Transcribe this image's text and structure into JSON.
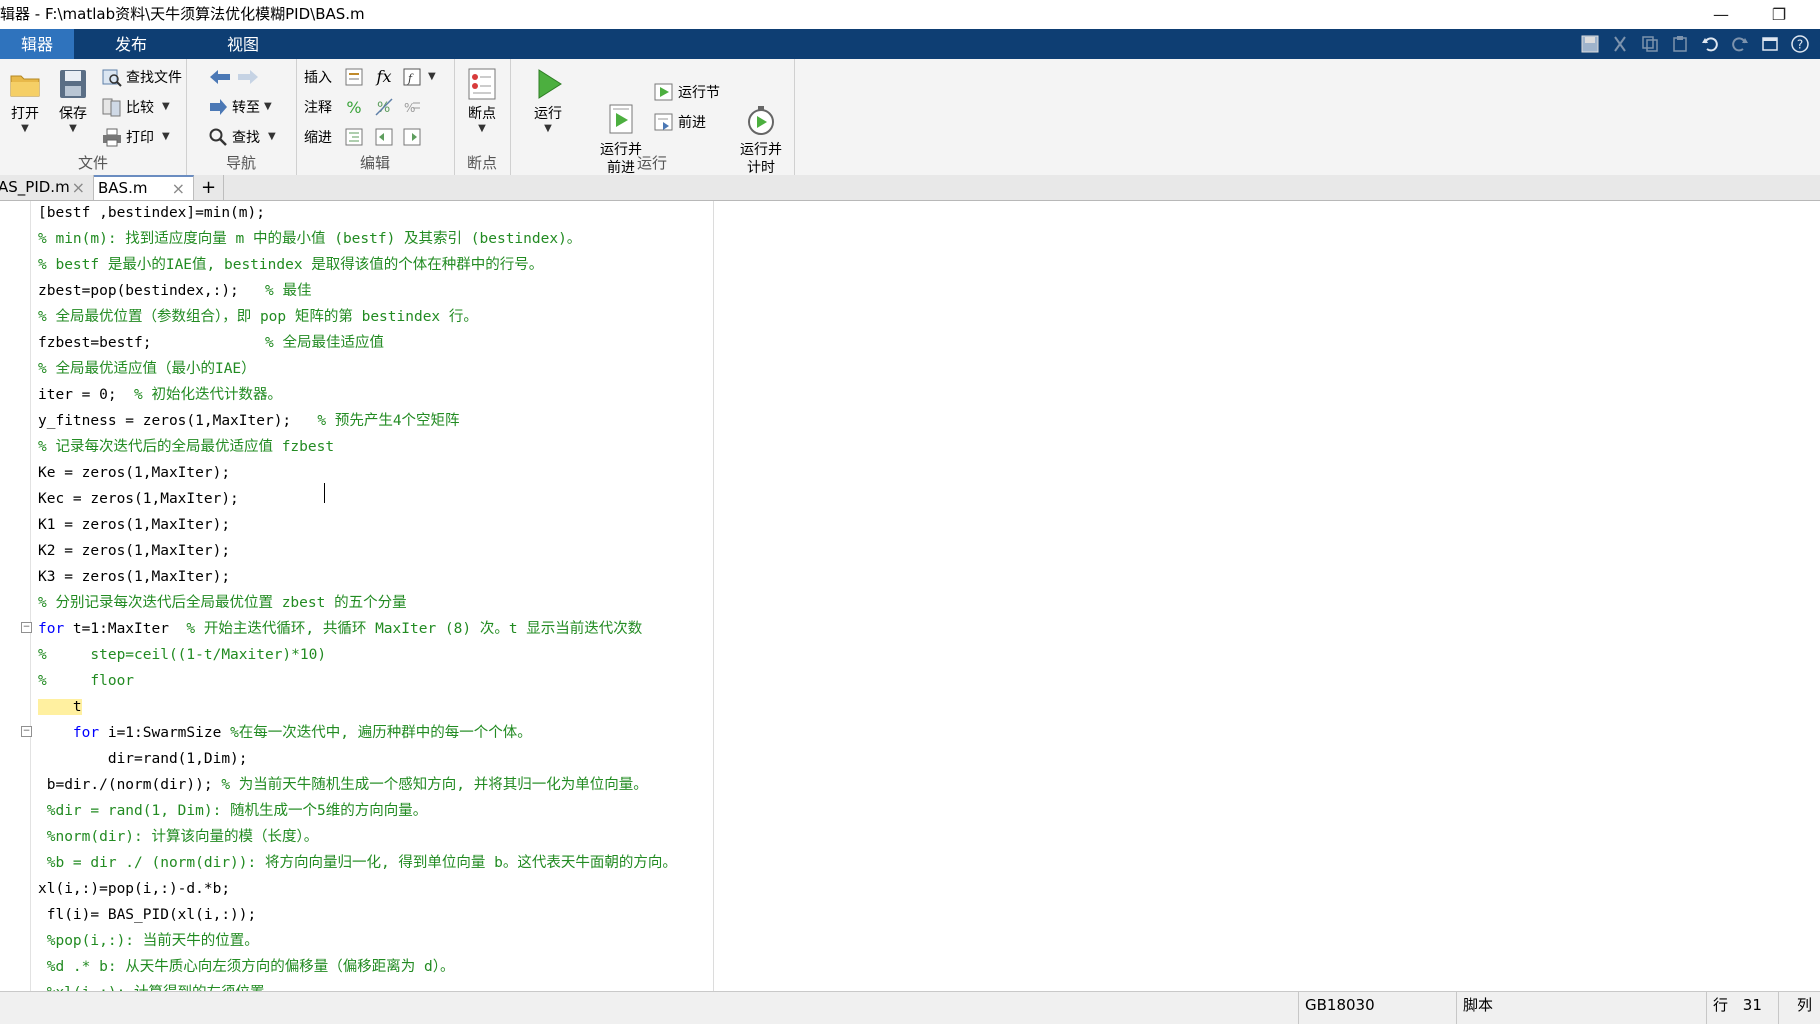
{
  "window": {
    "title": "辑器 - F:\\matlab资料\\天牛须算法优化模糊PID\\BAS.m",
    "minimize_glyph": "—",
    "restore_glyph": "❐"
  },
  "ribbon_tabs": [
    {
      "label": "辑器",
      "active": true
    },
    {
      "label": "发布",
      "active": false
    },
    {
      "label": "视图",
      "active": false
    }
  ],
  "quick_access_icons": [
    "save-icon",
    "cut-icon",
    "copy-icon",
    "paste-icon",
    "undo-icon",
    "redo-icon",
    "window-icon",
    "help-icon"
  ],
  "toolstrip": {
    "file": {
      "section_label": "文件",
      "open": "打开",
      "save": "保存",
      "find_files": "查找文件",
      "compare": "比较",
      "print": "打印"
    },
    "navigate": {
      "section_label": "导航",
      "goto": "转至",
      "find": "查找"
    },
    "edit": {
      "section_label": "编辑",
      "insert": "插入",
      "comment": "注释",
      "indent": "缩进",
      "fx": "fx",
      "percent": "%"
    },
    "breakpoints": {
      "section_label": "断点",
      "breakpoints": "断点"
    },
    "run": {
      "section_label": "运行",
      "run": "运行",
      "run_advance": "运行并\n前进",
      "run_section": "运行节",
      "advance": "前进",
      "run_time": "运行并\n计时"
    }
  },
  "file_tabs": [
    {
      "label": "AS_PID.m",
      "active": false
    },
    {
      "label": "BAS.m",
      "active": true
    }
  ],
  "add_tab_glyph": "+",
  "close_glyph": "×",
  "editor": {
    "lines": [
      {
        "code": "[bestf ,bestindex]=min(m);",
        "comment": ""
      },
      {
        "code": "",
        "comment": "% min(m): 找到适应度向量 m 中的最小值 (bestf) 及其索引 (bestindex)。"
      },
      {
        "code": "",
        "comment": "% bestf 是最小的IAE值, bestindex 是取得该值的个体在种群中的行号。"
      },
      {
        "code": "zbest=pop(bestindex,:);   ",
        "comment": "% 最佳"
      },
      {
        "code": "",
        "comment": "% 全局最优位置（参数组合），即 pop 矩阵的第 bestindex 行。"
      },
      {
        "code": "fzbest=bestf;             ",
        "comment": "% 全局最佳适应值"
      },
      {
        "code": "",
        "comment": "% 全局最优适应值（最小的IAE）"
      },
      {
        "code": "iter = 0;  ",
        "comment": "% 初始化迭代计数器。"
      },
      {
        "code": "y_fitness = zeros(1,MaxIter);   ",
        "comment": "% 预先产生4个空矩阵"
      },
      {
        "code": "",
        "comment": "% 记录每次迭代后的全局最优适应值 fzbest"
      },
      {
        "code": "Ke = zeros(1,MaxIter);",
        "comment": ""
      },
      {
        "code": "Kec = zeros(1,MaxIter);",
        "comment": ""
      },
      {
        "code": "K1 = zeros(1,MaxIter);",
        "comment": ""
      },
      {
        "code": "K2 = zeros(1,MaxIter);",
        "comment": ""
      },
      {
        "code": "K3 = zeros(1,MaxIter);",
        "comment": ""
      },
      {
        "code": "",
        "comment": "% 分别记录每次迭代后全局最优位置 zbest 的五个分量"
      },
      {
        "kw": "for",
        "code": " t=1:MaxIter  ",
        "comment": "% 开始主迭代循环, 共循环 MaxIter (8) 次。t 显示当前迭代次数"
      },
      {
        "code": "",
        "comment": "%     step=ceil((1-t/Maxiter)*10)"
      },
      {
        "code": "",
        "comment": "%     floor"
      },
      {
        "code": "    t",
        "comment": ""
      },
      {
        "kw": "    for",
        "code": " i=1:SwarmSize ",
        "comment": "%在每一次迭代中, 遍历种群中的每一个个体。"
      },
      {
        "code": "        dir=rand(1,Dim);",
        "comment": ""
      },
      {
        "code": " b=dir./(norm(dir)); ",
        "comment": "% 为当前天牛随机生成一个感知方向, 并将其归一化为单位向量。"
      },
      {
        "code": "",
        "comment": " %dir = rand(1, Dim): 随机生成一个5维的方向向量。"
      },
      {
        "code": "",
        "comment": " %norm(dir): 计算该向量的模（长度）。"
      },
      {
        "code": "",
        "comment": " %b = dir ./ (norm(dir)): 将方向向量归一化, 得到单位向量 b。这代表天牛面朝的方向。"
      },
      {
        "code": "xl(i,:)=pop(i,:)-d.*b;",
        "comment": ""
      },
      {
        "code": " fl(i)= BAS_PID(xl(i,:));",
        "comment": ""
      },
      {
        "code": "",
        "comment": " %pop(i,:): 当前天牛的位置。"
      },
      {
        "code": "",
        "comment": " %d .* b: 从天牛质心向左须方向的偏移量（偏移距离为 d）。"
      },
      {
        "code": "",
        "comment": " %xl(i,:): 计算得到的左须位置"
      }
    ]
  },
  "status": {
    "encoding": "GB18030",
    "file_type": "脚本",
    "row_label": "行",
    "row_value": "31",
    "col_label": "列"
  }
}
